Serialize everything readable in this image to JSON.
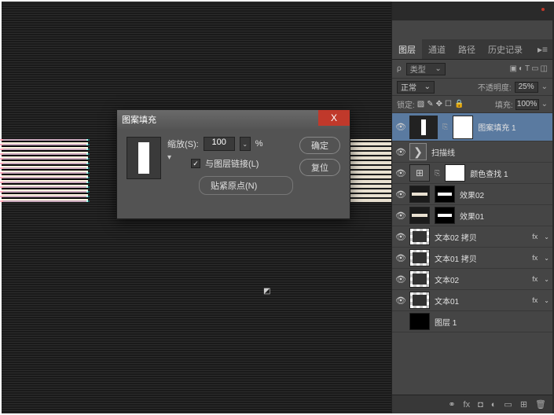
{
  "dialog": {
    "title": "图案填充",
    "close": "X",
    "scale_label": "缩放(S):",
    "scale_value": "100",
    "scale_unit": "%",
    "link_label": "与图层链接(L)",
    "snap_label": "贴紧原点(N)",
    "ok": "确定",
    "reset": "复位"
  },
  "panel": {
    "tabs": {
      "layers": "图层",
      "channels": "通道",
      "paths": "路径",
      "history": "历史记录"
    },
    "filter_kind": "类型",
    "blend_mode": "正常",
    "opacity_label": "不透明度:",
    "opacity_value": "25%",
    "lock_label": "锁定:",
    "fill_label": "填充:",
    "fill_value": "100%",
    "layers": [
      {
        "name": "图案填充 1"
      },
      {
        "name": "扫描线"
      },
      {
        "name": "颜色查找 1"
      },
      {
        "name": "效果02"
      },
      {
        "name": "效果01"
      },
      {
        "name": "文本02 拷贝"
      },
      {
        "name": "文本01 拷贝"
      },
      {
        "name": "文本02"
      },
      {
        "name": "文本01"
      },
      {
        "name": "图层 1"
      }
    ],
    "fx_label": "fx"
  }
}
